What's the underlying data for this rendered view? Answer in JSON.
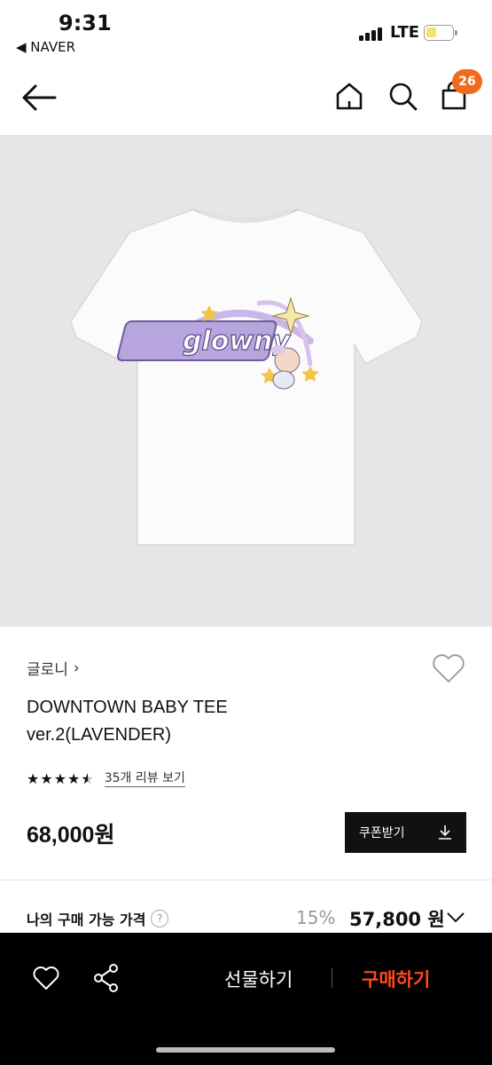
{
  "status": {
    "time": "9:31",
    "back_app": "◀ NAVER",
    "network": "LTE"
  },
  "nav": {
    "cart_count": "26"
  },
  "product": {
    "brand": "글로니",
    "brand_arrow": "›",
    "title_line1": "DOWNTOWN BABY TEE",
    "title_line2": "ver.2(LAVENDER)",
    "rating": 4.5,
    "review_link": "35개 리뷰 보기",
    "price": "68,000원",
    "coupon_label": "쿠폰받기",
    "my_price_label": "나의 구매 가능 가격",
    "discount": "15%",
    "final_price": "57,800 원",
    "print_text": "glowny",
    "colors": {
      "accent": "#f26a1b",
      "buy": "#ff4a1c",
      "graphic": "#8d7ab8"
    }
  },
  "bottom": {
    "gift_label": "선물하기",
    "buy_label": "구매하기"
  }
}
